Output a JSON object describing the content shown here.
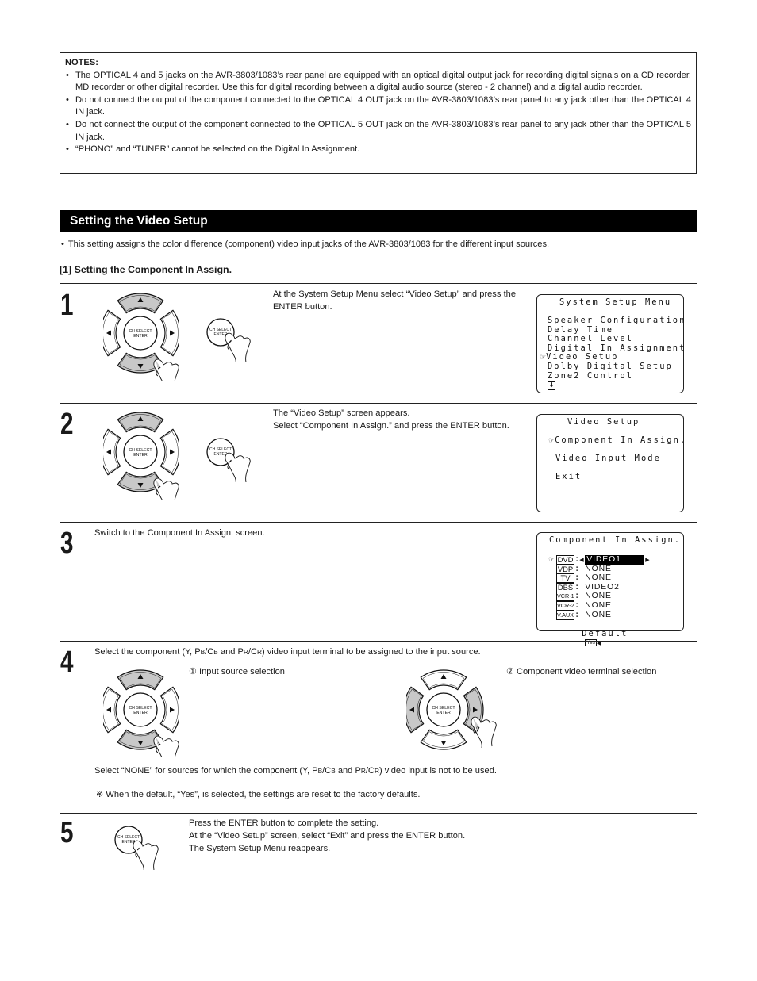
{
  "notes": {
    "title": "NOTES:",
    "items": [
      "The OPTICAL 4 and 5 jacks on the AVR-3803/1083’s rear panel are equipped with an optical digital output jack for recording digital signals on a CD recorder, MD recorder or other digital recorder. Use this for digital recording between a digital audio source (stereo - 2 channel) and a digital audio recorder.",
      "Do not connect the output of the component connected to the OPTICAL 4 OUT jack on the AVR-3803/1083’s rear panel to any jack other than the OPTICAL 4 IN jack.",
      "Do not connect the output of the component connected to the OPTICAL 5 OUT jack on the AVR-3803/1083’s rear panel to any jack other than the OPTICAL 5 IN jack.",
      "“PHONO” and “TUNER” cannot be selected on the Digital In Assignment."
    ]
  },
  "section": {
    "title": "Setting the Video Setup",
    "intro": "This setting assigns the color difference (component) video input jacks of the AVR-3803/1083 for the different input sources.",
    "subheading": "[1]  Setting the Component In Assign."
  },
  "remote": {
    "center_label_line1": "CH SELECT",
    "center_label_line2": "ENTER",
    "up_icon": "triangle-up",
    "down_icon": "triangle-down",
    "left_icon": "triangle-left",
    "right_icon": "triangle-right",
    "highlight_color": "#c8c8c8"
  },
  "steps": [
    {
      "number": "1",
      "text_lines": [
        "At the System Setup Menu select “Video Setup” and press the ENTER button."
      ],
      "screen": {
        "title": "System Setup Menu",
        "items": [
          "Speaker Configuration",
          "Delay Time",
          "Channel Level",
          "Digital In Assignment",
          "Video Setup",
          "Dolby Digital Setup",
          "Zone2 Control"
        ],
        "selected_index": 4,
        "cursor_icon": "☞",
        "more_icon": "⬇"
      }
    },
    {
      "number": "2",
      "text_lines": [
        "The “Video Setup” screen appears.",
        "Select “Component In Assign.” and press the ENTER button."
      ],
      "screen": {
        "title": "Video Setup",
        "items": [
          "Component In Assign.",
          "Video Input Mode",
          "Exit"
        ],
        "selected_index": 0,
        "cursor_icon": "☞"
      }
    },
    {
      "number": "3",
      "text": "Switch to the Component In Assign. screen.",
      "screen": {
        "title": "Component In Assign.",
        "cursor_icon": "☞",
        "rows": [
          {
            "source": "DVD",
            "value": "VIDEO1",
            "selected": true
          },
          {
            "source": "VDP",
            "value": "NONE"
          },
          {
            "source": "TV",
            "value": "NONE"
          },
          {
            "source": "DBS",
            "value": "VIDEO2"
          },
          {
            "source": "VCR-1",
            "value": "NONE"
          },
          {
            "source": "VCR-2",
            "value": "NONE"
          },
          {
            "source": "V.AUX",
            "value": "NONE"
          }
        ],
        "default_label": "Default",
        "default_value": "Yes",
        "left_arrow": "◀",
        "right_arrow": "▶"
      }
    },
    {
      "number": "4",
      "text_parts": [
        "Select the component (Y, P",
        "B",
        "/C",
        "B",
        " and P",
        "R",
        "/C",
        "R",
        ") video input terminal to be assigned to the input source."
      ],
      "sub1": "① Input source selection",
      "sub2": "② Component video terminal selection",
      "note_parts": [
        "Select “NONE” for sources for which the component (Y, P",
        "B",
        "/C",
        "B",
        " and P",
        "R",
        "/C",
        "R",
        ") video input is not to be used."
      ],
      "footnote": "※ When the default, “Yes”, is selected, the settings are reset to the factory defaults."
    },
    {
      "number": "5",
      "text_lines": [
        "Press the ENTER button to complete the setting.",
        "At the “Video Setup” screen, select “Exit” and press the ENTER button.",
        "The System Setup Menu reappears."
      ]
    }
  ]
}
